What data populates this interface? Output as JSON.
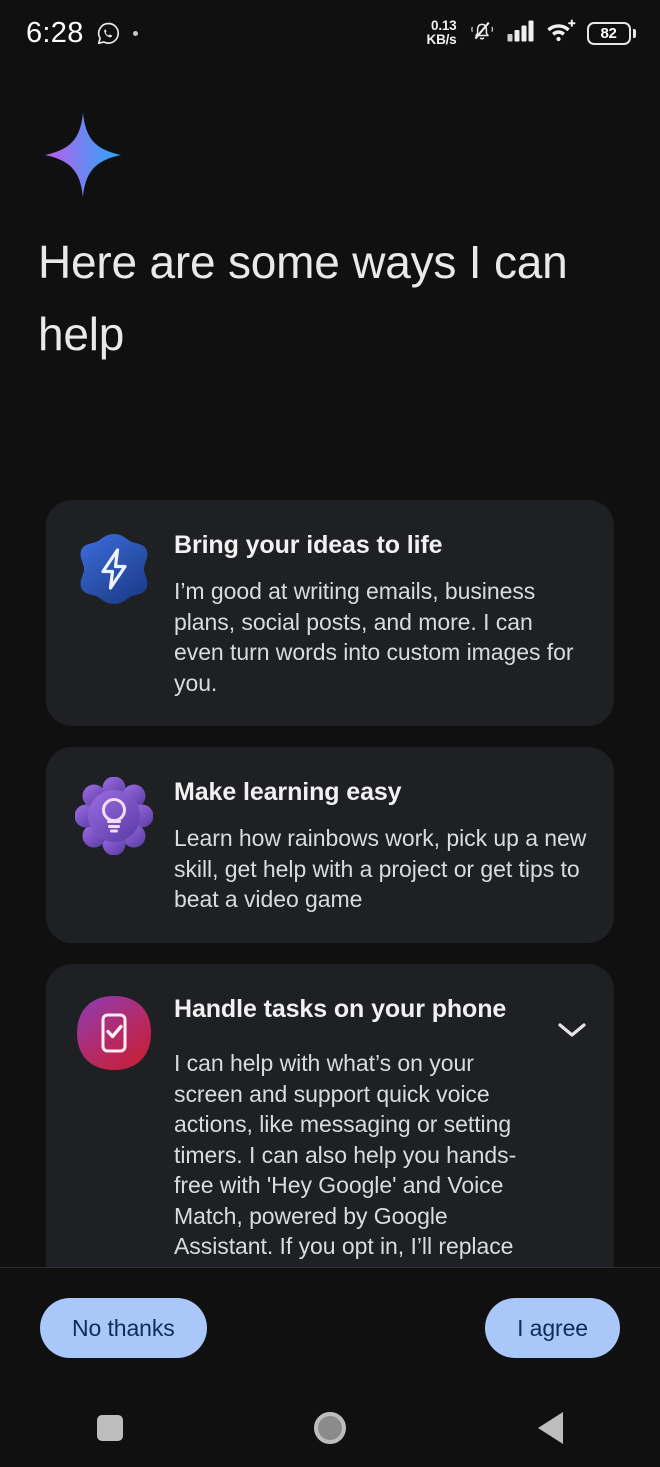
{
  "status_bar": {
    "clock": "6:28",
    "whatsapp_icon": "whatsapp-icon",
    "extra_dot_icon": "notification-dot-icon",
    "network_speed_value": "0.13",
    "network_speed_unit": "KB/s",
    "silent_icon": "bell-muted-icon",
    "signal_icon": "cellular-signal-icon",
    "wifi_icon": "wifi-plus-icon",
    "battery_level": "82",
    "battery_icon": "battery-icon"
  },
  "brand": {
    "logo_icon": "gemini-sparkle-icon",
    "gradient_start": "#c159e8",
    "gradient_mid": "#7b7ef0",
    "gradient_end": "#2fa3f7"
  },
  "header": {
    "title": "Here are some ways I can help"
  },
  "cards": [
    {
      "id": "bring-your-ideas-to-life",
      "icon": "lightning-bolt-blob-icon",
      "icon_color_start": "#2f5ec4",
      "icon_color_end": "#1d3f8f",
      "title": "Bring your ideas to life",
      "body": "I’m good at writing emails, business plans, social posts, and more. I can even turn words into custom images for you.",
      "expandable": false
    },
    {
      "id": "make-learning-easy",
      "icon": "lightbulb-flower-icon",
      "icon_color_start": "#8b5fd6",
      "icon_color_end": "#5b3fa8",
      "title": "Make learning easy",
      "body": "Learn how rainbows work, pick up a new skill, get help with a project or get tips to beat a video game",
      "expandable": false
    },
    {
      "id": "handle-tasks-on-your-phone",
      "icon": "phone-check-squircle-icon",
      "icon_color_start": "#8b3fae",
      "icon_color_end": "#c2203f",
      "title": "Handle tasks on your phone",
      "body": "I can help with what’s on your screen and support quick voice actions, like messaging or setting timers. I can also help you hands-free with 'Hey Google' and Voice Match, powered by Google Assistant. If you opt in, I’ll replace Google Assistant.",
      "expandable": true,
      "expand_icon": "chevron-down-icon"
    }
  ],
  "actions": {
    "decline_label": "No thanks",
    "accept_label": "I agree",
    "button_color": "#aac7fa",
    "button_text_color": "#0d2c5b"
  },
  "nav_bar": {
    "recents_icon": "recents-square-icon",
    "home_icon": "home-circle-icon",
    "back_icon": "back-triangle-icon"
  }
}
